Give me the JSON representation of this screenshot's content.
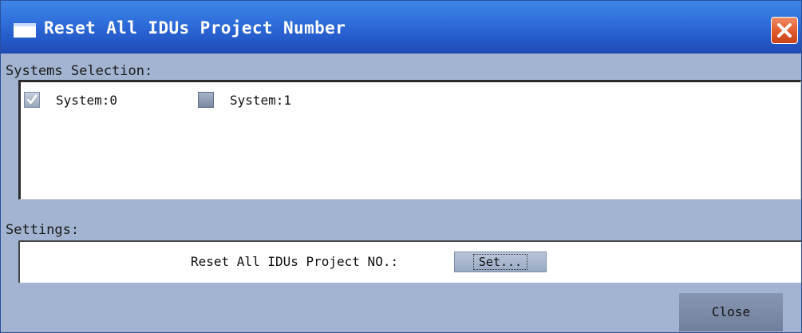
{
  "window": {
    "title": "Reset All IDUs Project Number",
    "title_icon": "window-icon",
    "close_icon": "close-x-icon"
  },
  "systems": {
    "label": "Systems Selection:",
    "items": [
      {
        "label": "System:0",
        "checked": true
      },
      {
        "label": "System:1",
        "checked": false
      }
    ]
  },
  "settings": {
    "label": "Settings:",
    "reset_label": "Reset All IDUs Project NO.:",
    "set_button": "Set..."
  },
  "footer": {
    "close_button": "Close"
  },
  "colors": {
    "titlebar": "#2f6fdb",
    "body": "#a2b4d1",
    "close_red": "#e05a2b"
  }
}
